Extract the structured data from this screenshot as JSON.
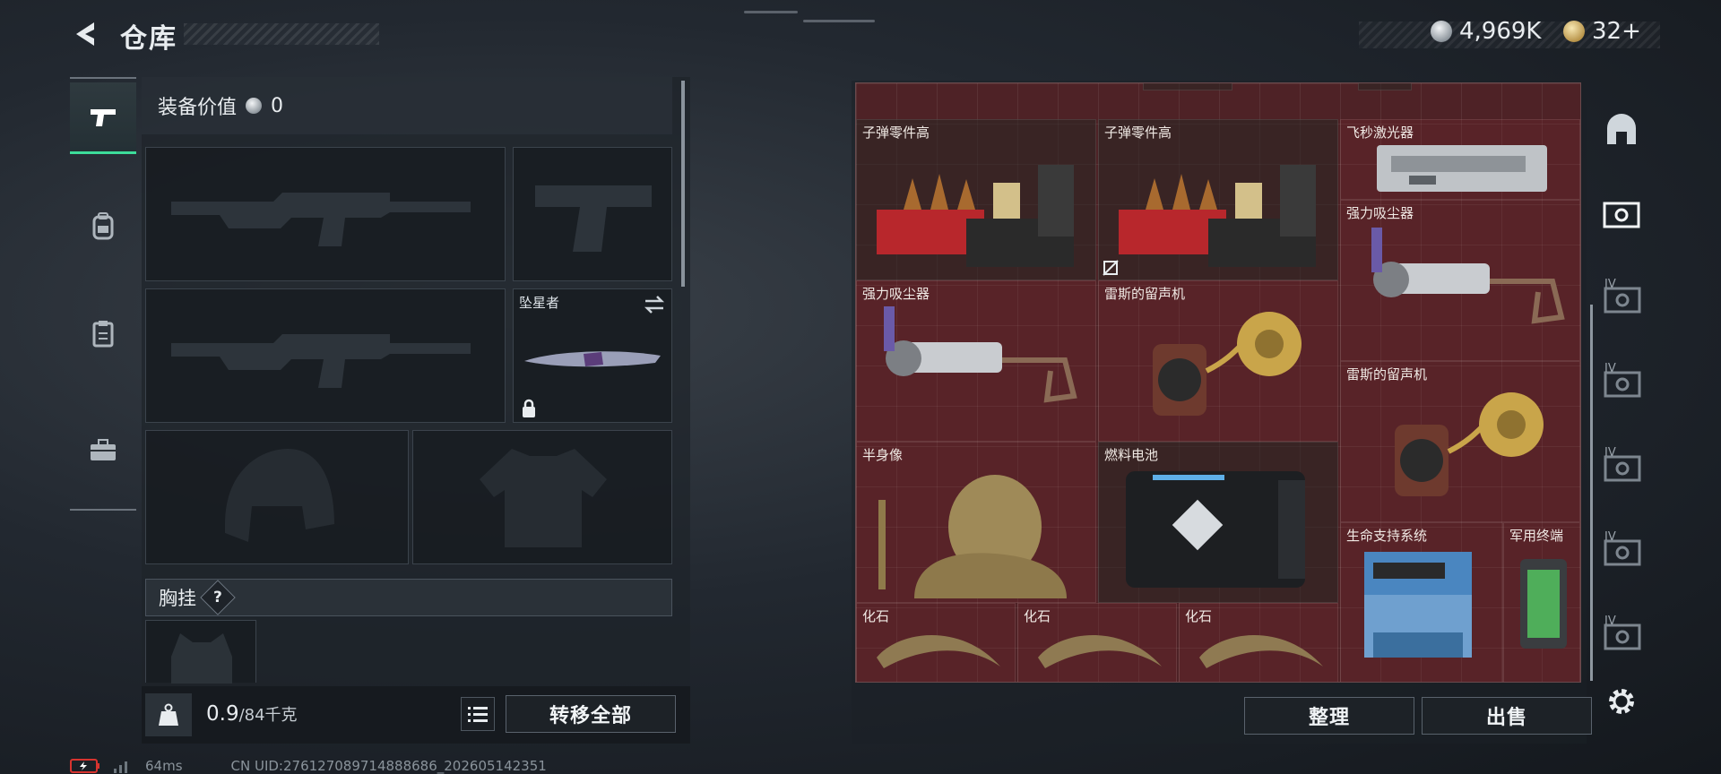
{
  "header": {
    "title": "仓库"
  },
  "currency": {
    "silver": "4,969K",
    "gold": "32+"
  },
  "equipment": {
    "value_label": "装备价值",
    "value": "0",
    "melee_label": "坠星者",
    "chest_rig_label": "胸挂",
    "help_mark": "?"
  },
  "weight": {
    "current": "0.9",
    "max": "/84千克"
  },
  "actions": {
    "transfer_all": "转移全部",
    "organize": "整理",
    "sell": "出售"
  },
  "items": [
    {
      "name": "子弹零件高"
    },
    {
      "name": "子弹零件高"
    },
    {
      "name": "飞秒激光器"
    },
    {
      "name": "强力吸尘器"
    },
    {
      "name": "强力吸尘器"
    },
    {
      "name": "雷斯的留声机"
    },
    {
      "name": "雷斯的留声机"
    },
    {
      "name": "半身像"
    },
    {
      "name": "燃料电池"
    },
    {
      "name": "生命支持系统"
    },
    {
      "name": "军用终端"
    },
    {
      "name": "化石"
    },
    {
      "name": "化石"
    },
    {
      "name": "化石"
    }
  ],
  "rail_badges": [
    "IV",
    "IV",
    "IV",
    "IV",
    "IV"
  ],
  "status": {
    "ping": "64ms",
    "uid": "CN UID:276127089714888686_202605142351"
  }
}
